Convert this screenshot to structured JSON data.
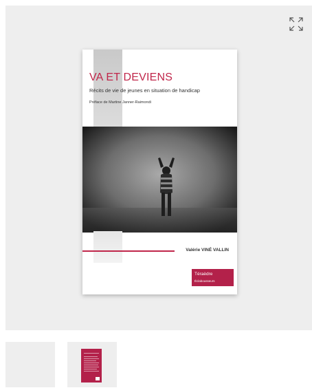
{
  "viewer": {
    "expand_icon": "expand-arrows-icon"
  },
  "book": {
    "title": "VA ET DEVIENS",
    "subtitle": "Récits de vie de jeunes en situation de handicap",
    "preface": "Préface de Martine Janner-Raimondi",
    "author": "Valérie VINÉ VALLIN",
    "publisher": "Téraèdre",
    "collection": "Éclabousseurs",
    "accent_color": "#c0264a"
  },
  "thumbnails": [
    {
      "name": "front-cover"
    },
    {
      "name": "back-cover"
    }
  ]
}
